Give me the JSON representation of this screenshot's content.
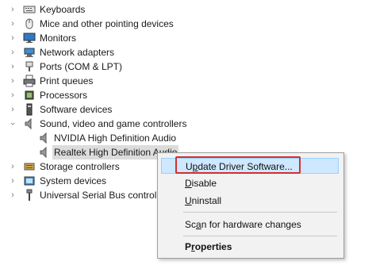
{
  "tree": {
    "items": [
      {
        "label": "Keyboards",
        "icon": "keyboard-icon",
        "expanded": false
      },
      {
        "label": "Mice and other pointing devices",
        "icon": "mouse-icon",
        "expanded": false
      },
      {
        "label": "Monitors",
        "icon": "monitor-icon",
        "expanded": false
      },
      {
        "label": "Network adapters",
        "icon": "network-adapter-icon",
        "expanded": false
      },
      {
        "label": "Ports (COM & LPT)",
        "icon": "port-icon",
        "expanded": false
      },
      {
        "label": "Print queues",
        "icon": "printer-icon",
        "expanded": false
      },
      {
        "label": "Processors",
        "icon": "processor-icon",
        "expanded": false
      },
      {
        "label": "Software devices",
        "icon": "software-device-icon",
        "expanded": false
      },
      {
        "label": "Sound, video and game controllers",
        "icon": "speaker-icon",
        "expanded": true,
        "children": [
          {
            "label": "NVIDIA High Definition Audio",
            "icon": "speaker-icon"
          },
          {
            "label": "Realtek High Definition Audio",
            "icon": "speaker-icon",
            "selected": true
          }
        ]
      },
      {
        "label": "Storage controllers",
        "icon": "storage-controller-icon",
        "expanded": false
      },
      {
        "label": "System devices",
        "icon": "system-device-icon",
        "expanded": false
      },
      {
        "label": "Universal Serial Bus controlle",
        "icon": "usb-icon",
        "expanded": false
      }
    ]
  },
  "context_menu": {
    "items": [
      {
        "label": "Update Driver Software...",
        "accel": "p",
        "highlighted": true
      },
      {
        "label": "Disable",
        "accel": "D"
      },
      {
        "label": "Uninstall",
        "accel": "U"
      },
      {
        "label": "Scan for hardware changes",
        "accel": "a"
      },
      {
        "label": "Properties",
        "accel": "r",
        "bold": true
      }
    ]
  },
  "colors": {
    "highlight_outline": "#d32f2f",
    "menu_hover_bg": "#cde8ff",
    "selected_row_bg": "#dcdcdc"
  }
}
